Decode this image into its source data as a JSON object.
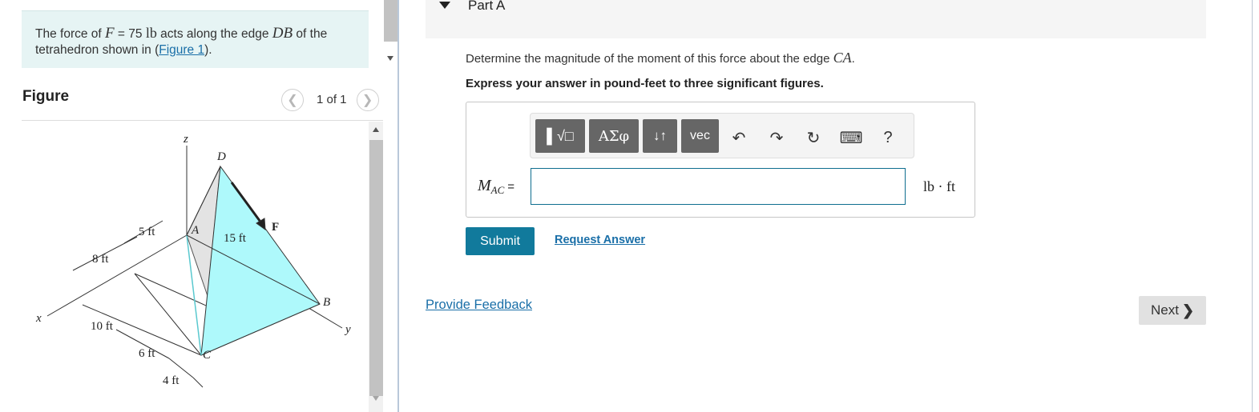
{
  "intro": {
    "part1": "The force of ",
    "f_var": "F",
    "part2": " = 75 ",
    "f_unit": "lb",
    "part3": " acts along the edge ",
    "edge": "DB",
    "part4": " of the tetrahedron shown in (",
    "figure_link": "Figure 1",
    "part5": ")."
  },
  "figure": {
    "title": "Figure",
    "counter": "1 of 1",
    "prev_icon": "chevron-left-icon",
    "next_icon": "chevron-right-icon",
    "labels": {
      "z": "z",
      "x": "x",
      "y": "y",
      "D": "D",
      "A": "A",
      "B": "B",
      "C": "C",
      "F": "F",
      "d5": "5 ft",
      "d8": "8 ft",
      "d15": "15 ft",
      "d10": "10 ft",
      "d6": "6 ft",
      "d4": "4 ft"
    },
    "colors": {
      "face": "#aef9fb",
      "shade": "#e3e3e3"
    }
  },
  "part": {
    "title": "Part A"
  },
  "question": {
    "text": "Determine the magnitude of the moment of this force about the edge ",
    "edge": "CA",
    "end": "."
  },
  "instruction": "Express your answer in pound-feet to three significant figures.",
  "toolbar": {
    "b1_text": "▌√□",
    "b2_text": "ΑΣφ",
    "b3_text": "↓↑",
    "b4_text": "vec",
    "undo": "↶",
    "redo": "↷",
    "reset": "↻",
    "keyboard": "⌨",
    "help": "?"
  },
  "answer": {
    "label_main": "M",
    "label_sub": "AC",
    "label_eq": "=",
    "value": "",
    "unit": "lb · ft"
  },
  "buttons": {
    "submit": "Submit",
    "request": "Request Answer",
    "feedback": "Provide Feedback",
    "next": "Next",
    "next_chev": "❯"
  },
  "accent_color": "#117a9c"
}
